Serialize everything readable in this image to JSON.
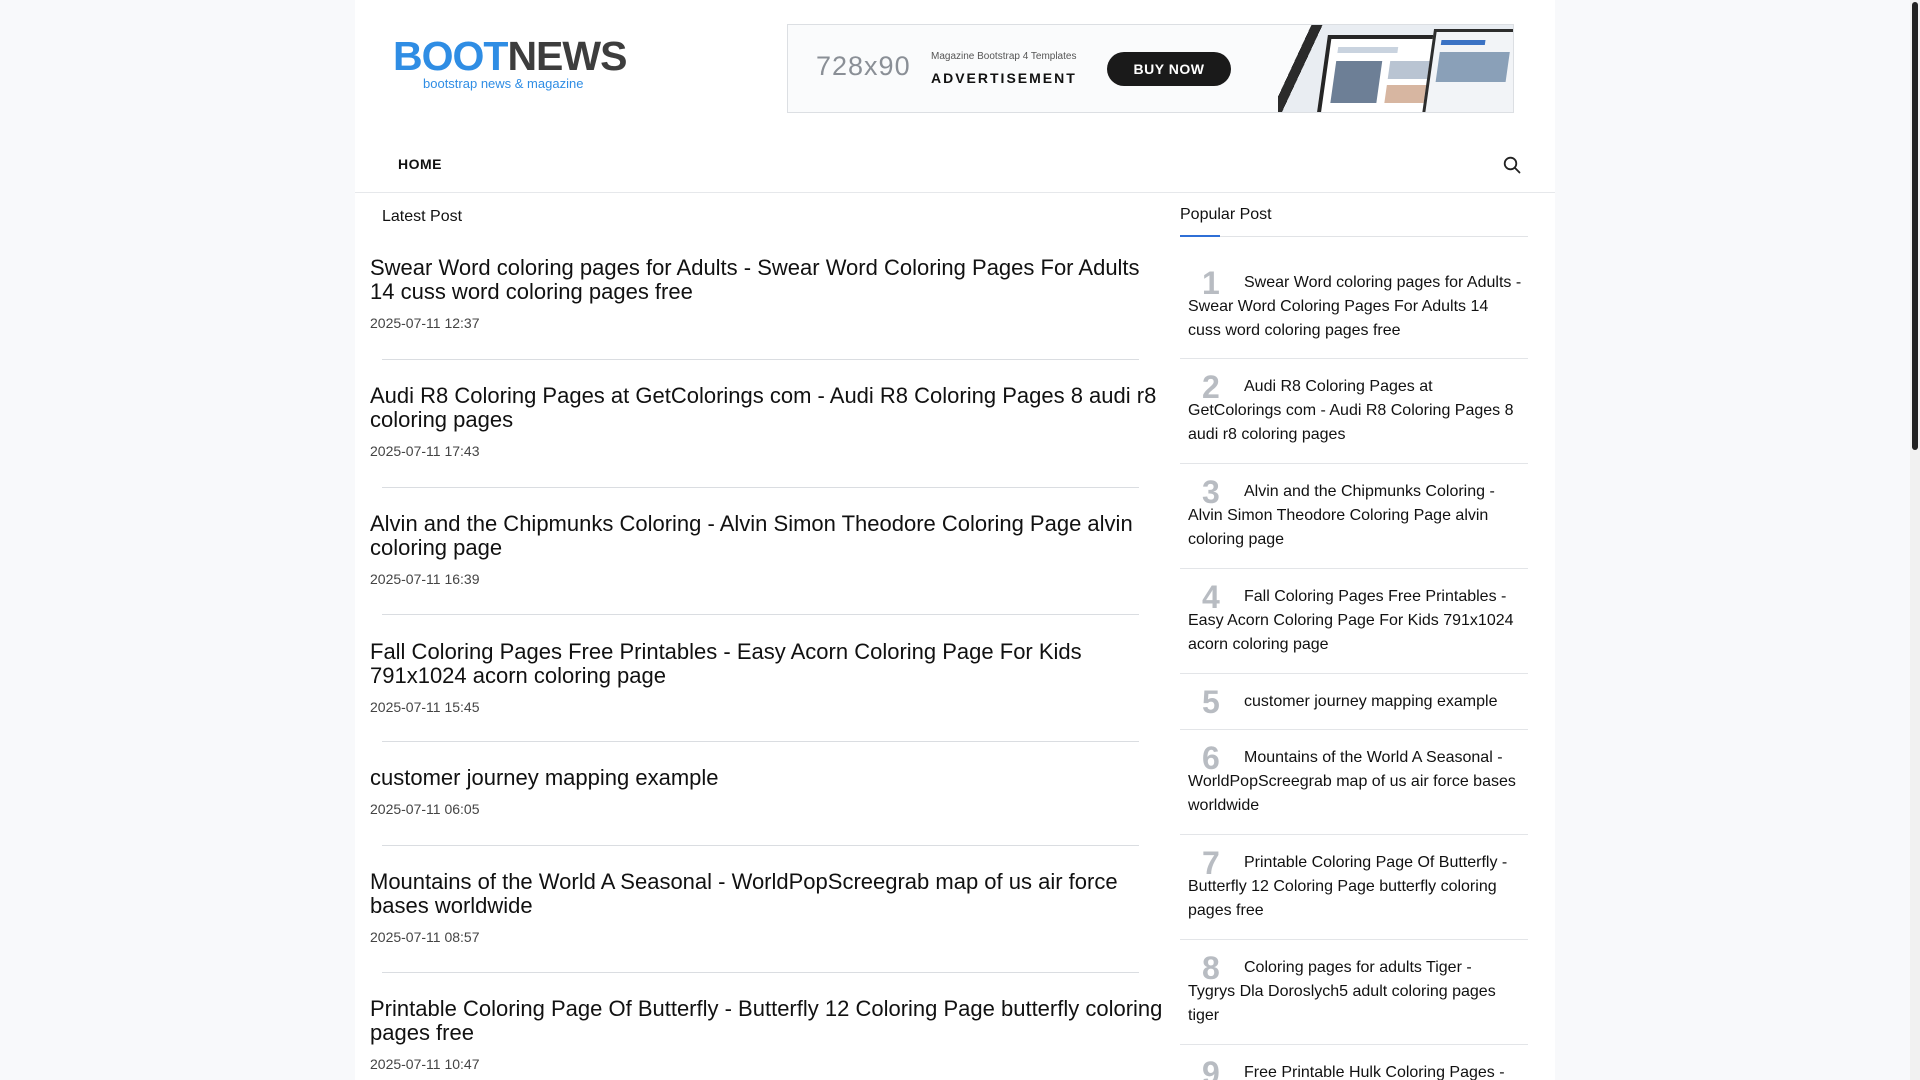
{
  "logo": {
    "part1": "BOOT",
    "part2": "NEWS",
    "tagline": "bootstrap news & magazine"
  },
  "ad": {
    "size": "728x90",
    "kicker": "Magazine Bootstrap 4 Templates",
    "title": "ADVERTISEMENT",
    "button": "BUY NOW"
  },
  "nav": {
    "home": "HOME",
    "search_icon": "search-icon"
  },
  "latest": {
    "title": "Latest Post",
    "posts": [
      {
        "title": "Swear Word coloring pages for Adults - Swear Word Coloring Pages For Adults 14 cuss word coloring pages free",
        "date": "2025-07-11 12:37"
      },
      {
        "title": "Audi R8 Coloring Pages at GetColorings com - Audi R8 Coloring Pages 8 audi r8 coloring pages",
        "date": "2025-07-11 17:43"
      },
      {
        "title": "Alvin and the Chipmunks Coloring - Alvin Simon Theodore Coloring Page alvin coloring page",
        "date": "2025-07-11 16:39"
      },
      {
        "title": "Fall Coloring Pages Free Printables - Easy Acorn Coloring Page For Kids 791x1024 acorn coloring page",
        "date": "2025-07-11 15:45"
      },
      {
        "title": "customer journey mapping example",
        "date": "2025-07-11 06:05"
      },
      {
        "title": "Mountains of the World A Seasonal - WorldPopScreegrab map of us air force bases worldwide",
        "date": "2025-07-11 08:57"
      },
      {
        "title": "Printable Coloring Page Of Butterfly - Butterfly 12 Coloring Page butterfly coloring pages free",
        "date": "2025-07-11 10:47"
      }
    ]
  },
  "popular": {
    "title": "Popular Post",
    "items": [
      {
        "num": "1",
        "text": "Swear Word coloring pages for Adults - Swear Word Coloring Pages For Adults 14 cuss word coloring pages free"
      },
      {
        "num": "2",
        "text": "Audi R8 Coloring Pages at GetColorings com - Audi R8 Coloring Pages 8 audi r8 coloring pages"
      },
      {
        "num": "3",
        "text": "Alvin and the Chipmunks Coloring - Alvin Simon Theodore Coloring Page alvin coloring page"
      },
      {
        "num": "4",
        "text": "Fall Coloring Pages Free Printables - Easy Acorn Coloring Page For Kids 791x1024 acorn coloring page"
      },
      {
        "num": "5",
        "text": "customer journey mapping example"
      },
      {
        "num": "6",
        "text": "Mountains of the World A Seasonal - WorldPopScreegrab map of us air force bases worldwide"
      },
      {
        "num": "7",
        "text": "Printable Coloring Page Of Butterfly - Butterfly 12 Coloring Page butterfly coloring pages free"
      },
      {
        "num": "8",
        "text": "Coloring pages for adults Tiger - Tygrys Dla Doroslych5 adult coloring pages tiger"
      },
      {
        "num": "9",
        "text": "Free Printable Hulk Coloring Pages -"
      }
    ]
  },
  "colors": {
    "accent": "#2f8de4",
    "popular_accent": "#2f6fd6",
    "page_bg": "#f8f9fb"
  }
}
